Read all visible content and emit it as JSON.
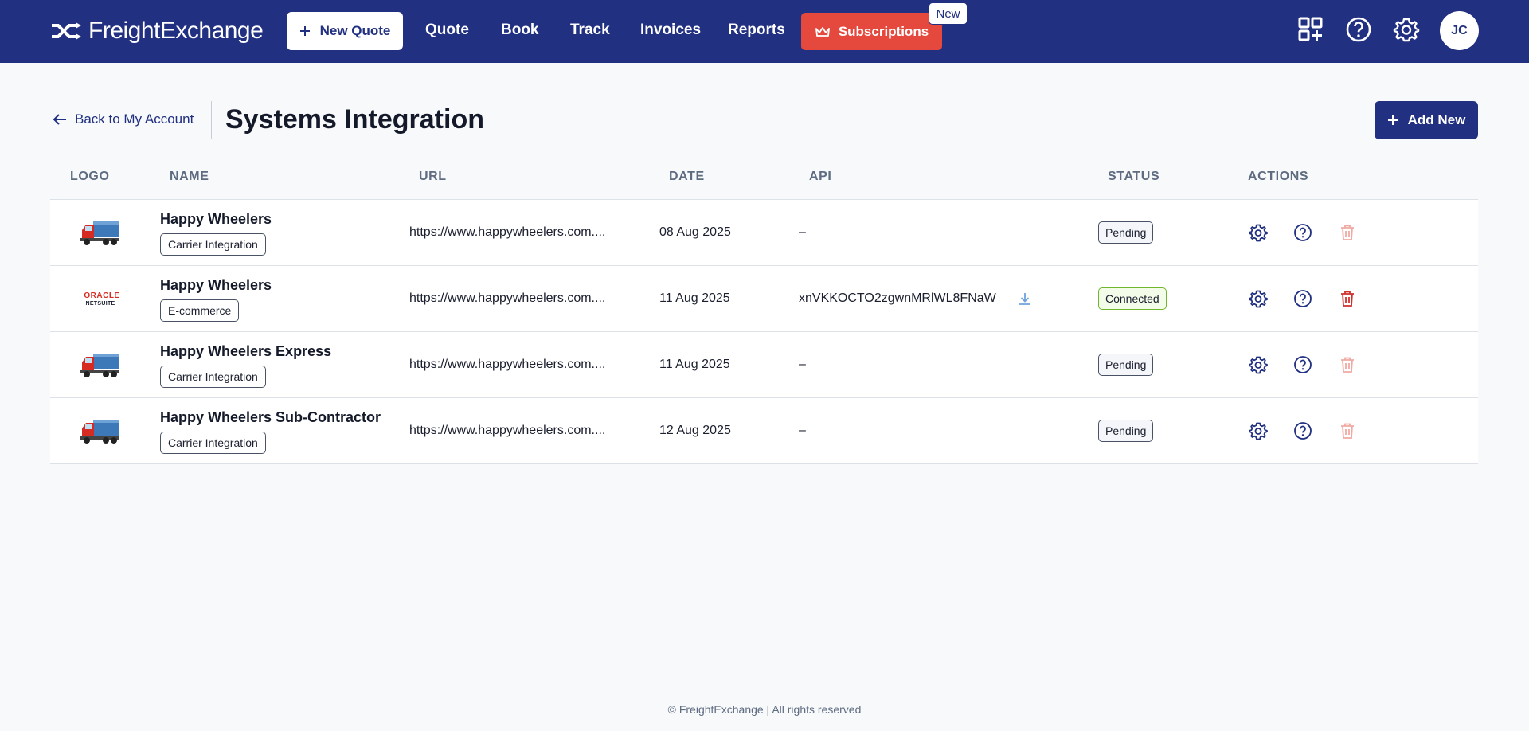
{
  "brand": {
    "name": "FreightExchange"
  },
  "nav": {
    "new_quote": "New Quote",
    "links": [
      "Quote",
      "Book",
      "Track",
      "Invoices",
      "Reports"
    ],
    "subscriptions": "Subscriptions",
    "new_badge": "New",
    "avatar_initials": "JC"
  },
  "page": {
    "back_label": "Back to My Account",
    "title": "Systems Integration",
    "add_new": "Add New"
  },
  "table": {
    "headers": [
      "LOGO",
      "NAME",
      "URL",
      "DATE",
      "API",
      "STATUS",
      "ACTIONS"
    ],
    "rows": [
      {
        "logo": "truck",
        "name": "Happy Wheelers",
        "tag": "Carrier Integration",
        "url": "https://www.happywheelers.com....",
        "date": "08 Aug 2025",
        "api": "–",
        "status": "Pending"
      },
      {
        "logo": "oracle-netsuite",
        "logo_text_top": "ORACLE",
        "logo_text_bottom": "NETSUITE",
        "name": "Happy Wheelers",
        "tag": "E-commerce",
        "url": "https://www.happywheelers.com....",
        "date": "11 Aug 2025",
        "api": "xnVKKOCTO2zgwnMRlWL8FNaW",
        "status": "Connected"
      },
      {
        "logo": "truck",
        "name": "Happy Wheelers Express",
        "tag": "Carrier Integration",
        "url": "https://www.happywheelers.com....",
        "date": "11 Aug 2025",
        "api": "–",
        "status": "Pending"
      },
      {
        "logo": "truck",
        "name": "Happy Wheelers Sub-Contractor",
        "tag": "Carrier Integration",
        "url": "https://www.happywheelers.com....",
        "date": "12 Aug 2025",
        "api": "–",
        "status": "Pending"
      }
    ]
  },
  "footer": {
    "text": "© FreightExchange | All rights reserved"
  },
  "colors": {
    "nav_bg": "#213080",
    "subscriptions_bg": "#e5493d",
    "delete_active": "#d0312d",
    "delete_disabled": "#f0a9a3",
    "connected_border": "#6fb82e"
  }
}
